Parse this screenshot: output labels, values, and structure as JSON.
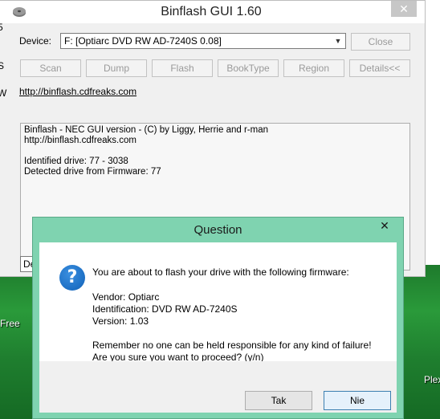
{
  "main_window": {
    "title": "Binflash GUI 1.60",
    "device_label": "Device:",
    "device_value": "F: [Optiarc  DVD RW AD-7240S  0.08]",
    "buttons": {
      "close": "Close",
      "scan": "Scan",
      "dump": "Dump",
      "flash": "Flash",
      "booktype": "BookType",
      "region": "Region",
      "details": "Details<<"
    },
    "link": "http://binflash.cdfreaks.com",
    "log_lines": [
      "Binflash - NEC GUI version - (C) by Liggy, Herrie and r-man",
      "http://binflash.cdfreaks.com",
      "",
      "Identified drive: 77 - 3038",
      "Detected drive from Firmware: 77"
    ],
    "status_text": "De"
  },
  "dialog": {
    "title": "Question",
    "message_lines": [
      "You are about to flash your drive with the following firmware:",
      "Vendor: Optiarc",
      "Identification: DVD RW AD-7240S",
      "Version: 1.03",
      "Remember no one can be held responsible for any kind of failure!",
      "Are you sure you want to proceed? (y/n)"
    ],
    "yes_label": "Tak",
    "no_label": "Nie"
  },
  "desktop": {
    "label_left": "Free",
    "label_right": "Plex"
  },
  "edge_fragments": {
    "left_5": "5",
    "left_s": "S",
    "left_w": "W"
  }
}
